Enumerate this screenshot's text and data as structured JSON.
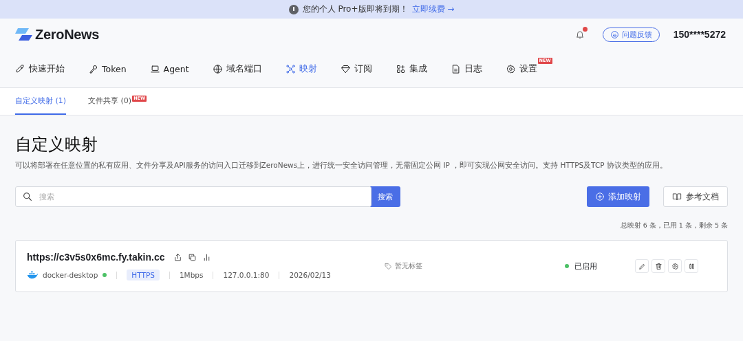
{
  "banner": {
    "text": "您的个人 Pro+版即将到期！",
    "link": "立即续费 →"
  },
  "header": {
    "logo": "ZeroNews",
    "notification_unread": true,
    "feedback": "问题反馈",
    "user": "150****5272"
  },
  "nav": [
    {
      "label": "快速开始",
      "selected": false
    },
    {
      "label": "Token",
      "selected": false
    },
    {
      "label": "Agent",
      "selected": false
    },
    {
      "label": "域名端口",
      "selected": false
    },
    {
      "label": "映射",
      "selected": true
    },
    {
      "label": "订阅",
      "selected": false
    },
    {
      "label": "集成",
      "selected": false
    },
    {
      "label": "日志",
      "selected": false
    },
    {
      "label": "设置",
      "selected": false,
      "badge": "NEW"
    }
  ],
  "subtabs": [
    {
      "label": "自定义映射 (1)",
      "selected": true
    },
    {
      "label": "文件共享 (0)",
      "selected": false,
      "badge": "NEW"
    }
  ],
  "page": {
    "title": "自定义映射",
    "description": "可以将部署在任意位置的私有应用、文件分享及API服务的访问入口迁移到ZeroNews上，进行统一安全访问管理，无需固定公网 IP ，即可实现公网安全访问。支持 HTTPS及TCP 协议类型的应用。"
  },
  "search": {
    "placeholder": "搜索",
    "button": "搜索"
  },
  "actions": {
    "add": "添加映射",
    "docs": "参考文档"
  },
  "quota": "总映射 6 条，已用 1 条，剩余 5 条",
  "mappings": [
    {
      "url": "https://c3v5s0x6mc.fy.takin.cc",
      "agent": "docker-desktop",
      "agent_online": true,
      "protocol": "HTTPS",
      "bandwidth": "1Mbps",
      "target": "127.0.0.1:80",
      "date": "2026/02/13",
      "tags": "暂无标签",
      "enabled": true,
      "status": "已启用"
    }
  ]
}
